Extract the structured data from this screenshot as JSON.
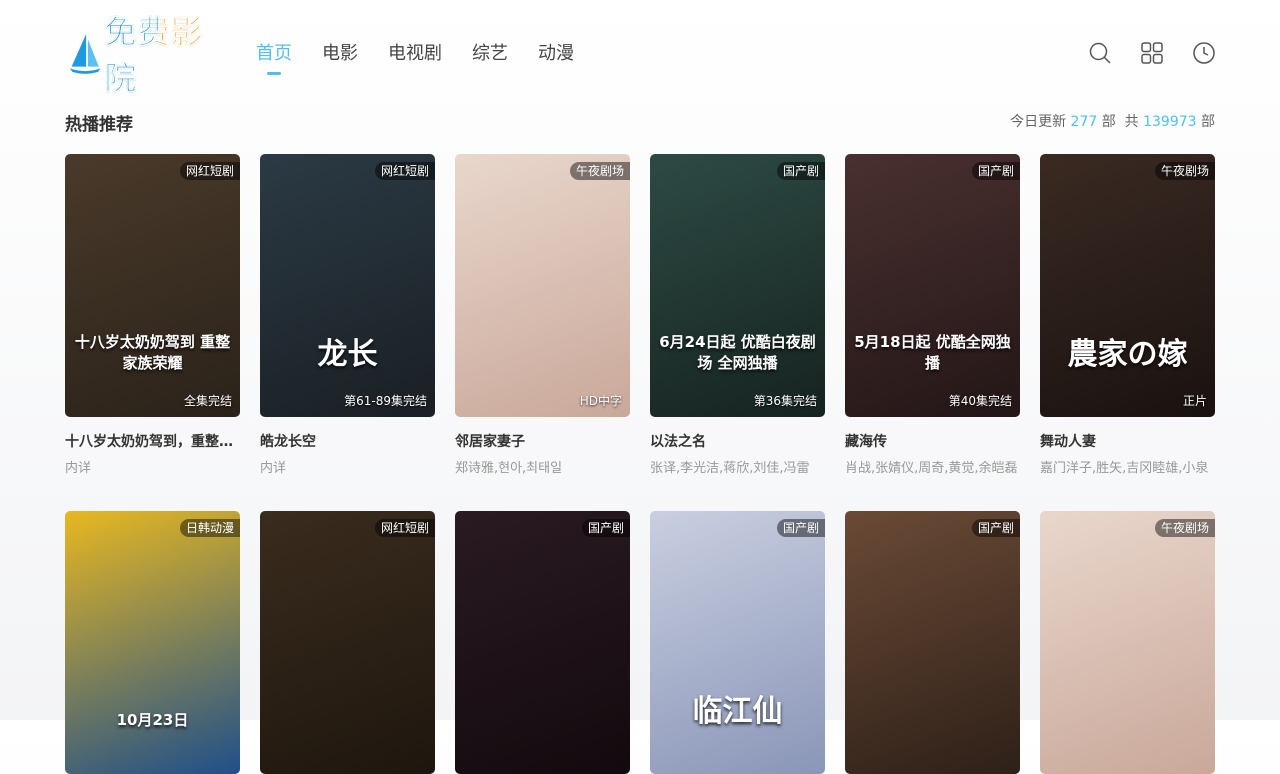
{
  "brand": {
    "logo_text": "免费影院"
  },
  "nav": [
    {
      "label": "首页",
      "active": true
    },
    {
      "label": "电影",
      "active": false
    },
    {
      "label": "电视剧",
      "active": false
    },
    {
      "label": "综艺",
      "active": false
    },
    {
      "label": "动漫",
      "active": false
    }
  ],
  "header_icons": [
    "search-icon",
    "grid-icon",
    "history-icon"
  ],
  "section": {
    "title": "热播推荐",
    "today_prefix": "今日更新",
    "today_count": "277",
    "unit1": "部",
    "total_prefix": "共",
    "total_count": "139973",
    "unit2": "部"
  },
  "cards": [
    {
      "tag": "网红短剧",
      "status": "全集完结",
      "title": "十八岁太奶奶驾到，重整家族荣耀",
      "sub": "内详",
      "poster_text": "十八岁太奶奶驾到 重整家族荣耀",
      "colors": [
        "#4a3a2a",
        "#2a221a"
      ]
    },
    {
      "tag": "网红短剧",
      "status": "第61-89集完结",
      "title": "皓龙长空",
      "sub": "内详",
      "poster_text": "龙长",
      "colors": [
        "#2b3a44",
        "#1a1f24"
      ]
    },
    {
      "tag": "午夜剧场",
      "status": "HD中字",
      "title": "邻居家妻子",
      "sub": "郑诗雅,현아,최태일",
      "poster_text": "",
      "colors": [
        "#e9d7cc",
        "#c9a89a"
      ]
    },
    {
      "tag": "国产剧",
      "status": "第36集完结",
      "title": "以法之名",
      "sub": "张译,李光洁,蒋欣,刘佳,冯雷",
      "poster_text": "6月24日起 优酷白夜剧场 全网独播",
      "colors": [
        "#2d4a44",
        "#162320"
      ]
    },
    {
      "tag": "国产剧",
      "status": "第40集完结",
      "title": "藏海传",
      "sub": "肖战,张婧仪,周奇,黄觉,余皑磊",
      "poster_text": "5月18日起 优酷全网独播",
      "colors": [
        "#4a3030",
        "#231616"
      ]
    },
    {
      "tag": "午夜剧场",
      "status": "正片",
      "title": "舞动人妻",
      "sub": "嘉门洋子,胜矢,吉冈睦雄,小泉",
      "poster_text": "農家の嫁",
      "colors": [
        "#3a2a22",
        "#1a1210"
      ]
    },
    {
      "tag": "日韩动漫",
      "status": "",
      "title": "",
      "sub": "",
      "poster_text": "10月23日",
      "colors": [
        "#e8b820",
        "#1f4f8a"
      ]
    },
    {
      "tag": "网红短剧",
      "status": "",
      "title": "",
      "sub": "",
      "poster_text": "",
      "colors": [
        "#3a2c1e",
        "#1e160e"
      ]
    },
    {
      "tag": "国产剧",
      "status": "",
      "title": "",
      "sub": "",
      "poster_text": "",
      "colors": [
        "#2a1a22",
        "#120a0e"
      ]
    },
    {
      "tag": "国产剧",
      "status": "",
      "title": "",
      "sub": "",
      "poster_text": "临江仙",
      "colors": [
        "#c9cfe0",
        "#8a96b8"
      ]
    },
    {
      "tag": "国产剧",
      "status": "",
      "title": "",
      "sub": "",
      "poster_text": "",
      "colors": [
        "#6a4a36",
        "#2e2018"
      ]
    },
    {
      "tag": "午夜剧场",
      "status": "",
      "title": "",
      "sub": "",
      "poster_text": "",
      "colors": [
        "#e9d7cc",
        "#c9a89a"
      ]
    }
  ]
}
